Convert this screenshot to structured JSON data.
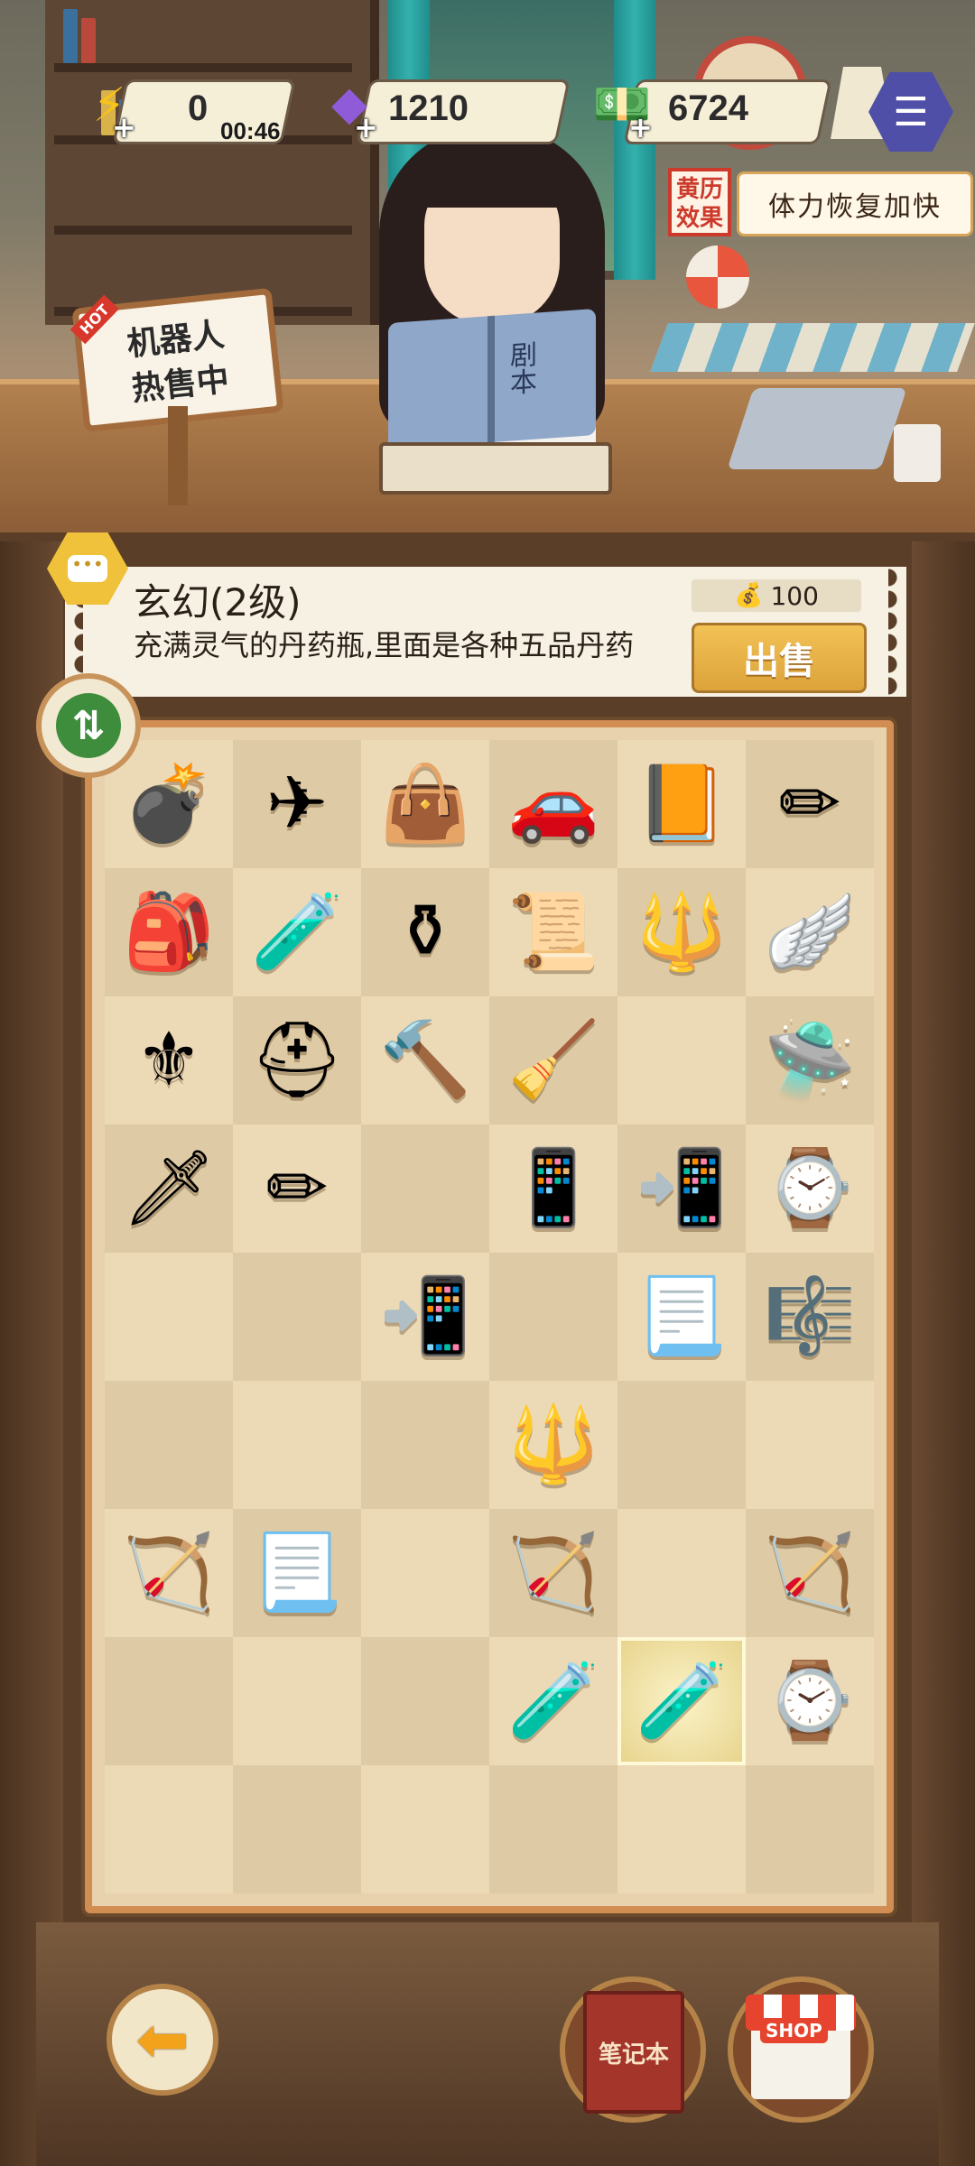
{
  "header": {
    "energy": {
      "value": "0",
      "timer": "00:46",
      "icon": "lightning-icon"
    },
    "gems": {
      "value": "1210",
      "icon": "purple-gem-icon"
    },
    "cash": {
      "value": "6724",
      "icon": "cash-stack-icon"
    },
    "notes_icon": "notebook-help-icon"
  },
  "almanac": {
    "tag": "黄历效果",
    "text": "体力恢复加快"
  },
  "signboard": {
    "hot": "HOT",
    "line1": "机器人",
    "line2": "热售中"
  },
  "girl_book_text": "剧本",
  "info": {
    "title": "玄幻(2级)",
    "description": "充满灵气的丹药瓶,里面是各种五品丹药",
    "price": "100",
    "sell_label": "出售"
  },
  "grid": [
    [
      "cannon",
      "fighter-jet",
      "handbag",
      "sports-car",
      "ancient-book",
      "pencil"
    ],
    [
      "backpack",
      "potion-bottle",
      "alchemy-cauldron",
      "magic-scroll",
      "golden-staff",
      "angel-wings"
    ],
    [
      "jeweled-scepter",
      "gladiator-helmet",
      "war-hammer",
      "witch-broom",
      "",
      "ufo"
    ],
    [
      "short-sword",
      "pencil",
      "",
      "tablet-device",
      "flip-phone",
      "smartwatch"
    ],
    [
      "",
      "",
      "flip-phone",
      "",
      "paper-scroll",
      "harp"
    ],
    [
      "",
      "",
      "",
      "golden-staff",
      "",
      ""
    ],
    [
      "siege-crossbow",
      "paper-scroll",
      "",
      "siege-crossbow",
      "",
      "siege-crossbow"
    ],
    [
      "",
      "",
      "",
      "potion-bottle",
      "potion-bottle",
      "smartwatch"
    ],
    [
      "",
      "",
      "",
      "",
      "",
      ""
    ]
  ],
  "selected_cell": [
    7,
    4
  ],
  "icons": {
    "cannon": "💣",
    "fighter-jet": "✈",
    "handbag": "👜",
    "sports-car": "🚗",
    "ancient-book": "📙",
    "pencil": "✏",
    "backpack": "🎒",
    "potion-bottle": "🧪",
    "alchemy-cauldron": "⚱",
    "magic-scroll": "📜",
    "golden-staff": "🔱",
    "angel-wings": "🪽",
    "jeweled-scepter": "⚜",
    "gladiator-helmet": "⛑",
    "war-hammer": "🔨",
    "witch-broom": "🧹",
    "ufo": "🛸",
    "short-sword": "🗡",
    "tablet-device": "📱",
    "flip-phone": "📲",
    "smartwatch": "⌚",
    "paper-scroll": "📃",
    "harp": "🎼",
    "siege-crossbow": "🏹"
  },
  "bottom": {
    "back_icon": "back-arrow-icon",
    "notebook_label": "笔记本",
    "shop_label": "SHOP"
  },
  "colors": {
    "accent": "#f0c13a",
    "sell": "#dca33b",
    "frame": "#d28d52"
  }
}
